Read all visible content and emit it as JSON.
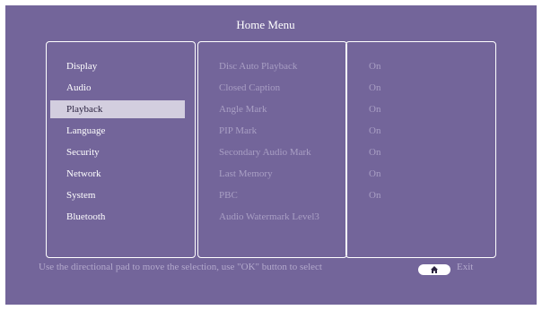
{
  "header": {
    "title": "Home Menu"
  },
  "categories": [
    {
      "label": "Display",
      "selected": false
    },
    {
      "label": "Audio",
      "selected": false
    },
    {
      "label": "Playback",
      "selected": true
    },
    {
      "label": "Language",
      "selected": false
    },
    {
      "label": "Security",
      "selected": false
    },
    {
      "label": "Network",
      "selected": false
    },
    {
      "label": "System",
      "selected": false
    },
    {
      "label": "Bluetooth",
      "selected": false
    }
  ],
  "settings": [
    {
      "name": "Disc Auto Playback",
      "value": "On"
    },
    {
      "name": "Closed Caption",
      "value": "On"
    },
    {
      "name": "Angle Mark",
      "value": "On"
    },
    {
      "name": "PIP Mark",
      "value": "On"
    },
    {
      "name": "Secondary Audio Mark",
      "value": "On"
    },
    {
      "name": "Last Memory",
      "value": "On"
    },
    {
      "name": "PBC",
      "value": "On"
    },
    {
      "name": "Audio Watermark Level3",
      "value": ""
    }
  ],
  "footer": {
    "hint": "Use the directional pad to move the selection, use \"OK\" button to select",
    "home_icon": "home-icon",
    "exit_label": "Exit"
  },
  "colors": {
    "background": "#73659a",
    "selection": "#d3cedf",
    "dim_text": "#a99fc4"
  }
}
